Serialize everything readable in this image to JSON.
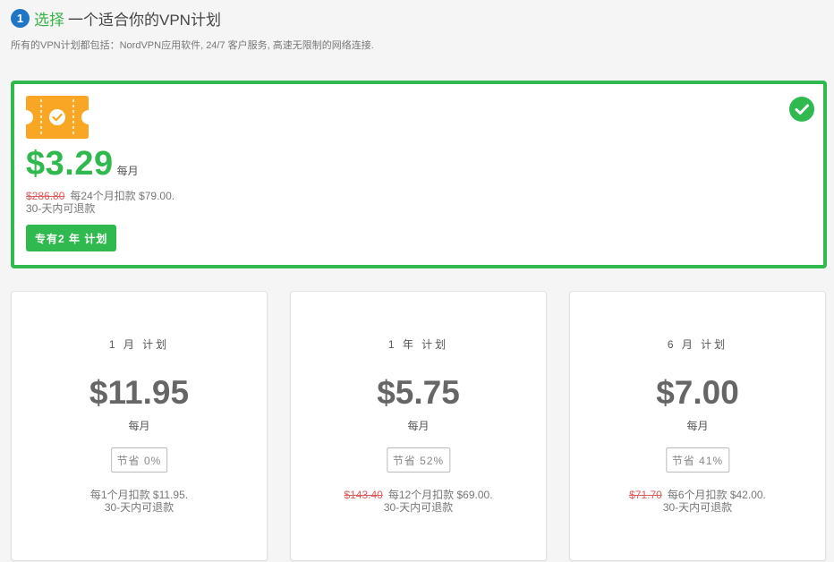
{
  "header": {
    "step": "1",
    "title_strong": "选择",
    "title_rest": "一个适合你的VPN计划",
    "subtitle": "所有的VPN计划都包括：NordVPN应用软件, 24/7 客户服务, 高速无限制的网络连接."
  },
  "featured": {
    "icon": "coupon-icon",
    "selected_icon": "check-circle-icon",
    "price": "$3.29",
    "per": "每月",
    "original_price": "$286.80",
    "billing": "每24个月扣款 $79.00.",
    "refund": "30-天内可退款",
    "button_label": "专有2 年 计划",
    "colors": {
      "accent": "#30b94e",
      "coupon": "#f8a623"
    }
  },
  "plans": [
    {
      "name": "1 月 计划",
      "price": "$11.95",
      "per": "每月",
      "save": "节省 0%",
      "original_price": "",
      "billing": "每1个月扣款 $11.95.",
      "refund": "30-天内可退款"
    },
    {
      "name": "1 年 计划",
      "price": "$5.75",
      "per": "每月",
      "save": "节省 52%",
      "original_price": "$143.40",
      "billing": "每12个月扣款 $69.00.",
      "refund": "30-天内可退款"
    },
    {
      "name": "6 月 计划",
      "price": "$7.00",
      "per": "每月",
      "save": "节省 41%",
      "original_price": "$71.70",
      "billing": "每6个月扣款 $42.00.",
      "refund": "30-天内可退款"
    }
  ]
}
